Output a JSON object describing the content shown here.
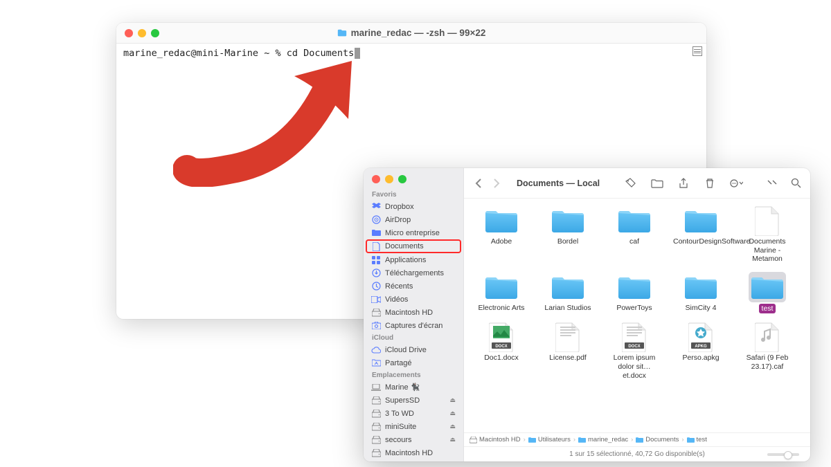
{
  "terminal": {
    "title": "marine_redac — -zsh — 99×22",
    "prompt": "marine_redac@mini-Marine ~ % ",
    "command": "cd Documents"
  },
  "finder": {
    "toolbar": {
      "title": "Documents — Local"
    },
    "sidebar": {
      "sections": [
        {
          "label": "Favoris",
          "items": [
            {
              "icon": "dropbox",
              "label": "Dropbox"
            },
            {
              "icon": "airdrop",
              "label": "AirDrop"
            },
            {
              "icon": "folder",
              "label": "Micro entreprise"
            },
            {
              "icon": "doc",
              "label": "Documents",
              "highlight": true
            },
            {
              "icon": "grid",
              "label": "Applications"
            },
            {
              "icon": "download",
              "label": "Téléchargements"
            },
            {
              "icon": "clock",
              "label": "Récents"
            },
            {
              "icon": "video",
              "label": "Vidéos"
            },
            {
              "icon": "disk",
              "label": "Macintosh HD"
            },
            {
              "icon": "camera",
              "label": "Captures d'écran"
            }
          ]
        },
        {
          "label": "iCloud",
          "items": [
            {
              "icon": "icloud",
              "label": "iCloud Drive"
            },
            {
              "icon": "shared",
              "label": "Partagé"
            }
          ]
        },
        {
          "label": "Emplacements",
          "items": [
            {
              "icon": "laptop",
              "label": "Marine 🐈‍⬛"
            },
            {
              "icon": "disk",
              "label": "SupersSD",
              "eject": true
            },
            {
              "icon": "disk",
              "label": "3 To WD",
              "eject": true
            },
            {
              "icon": "disk",
              "label": "miniSuite",
              "eject": true
            },
            {
              "icon": "disk",
              "label": "secours",
              "eject": true
            },
            {
              "icon": "disk",
              "label": "Macintosh HD"
            }
          ]
        }
      ]
    },
    "items": [
      {
        "type": "folder",
        "label": "Adobe"
      },
      {
        "type": "folder",
        "label": "Bordel"
      },
      {
        "type": "folder",
        "label": "caf"
      },
      {
        "type": "folder",
        "label": "ContourDesignSoftware"
      },
      {
        "type": "txt",
        "label": "Documents Marine - Metamon"
      },
      {
        "type": "folder",
        "label": "Electronic Arts"
      },
      {
        "type": "folder",
        "label": "Larian Studios"
      },
      {
        "type": "folder",
        "label": "PowerToys"
      },
      {
        "type": "folder",
        "label": "SimCity 4"
      },
      {
        "type": "folder",
        "label": "test",
        "selected": true
      },
      {
        "type": "docx",
        "label": "Doc1.docx",
        "badge": "DOCX",
        "thumb": "photo"
      },
      {
        "type": "pdf",
        "label": "License.pdf",
        "thumb": "text"
      },
      {
        "type": "docx",
        "label": "Lorem ipsum dolor sit…et.docx",
        "badge": "DOCX",
        "thumb": "text"
      },
      {
        "type": "apkg",
        "label": "Perso.apkg",
        "badge": "APKG",
        "thumb": "anki"
      },
      {
        "type": "caf",
        "label": "Safari (9 Feb 23.17).caf",
        "thumb": "audio"
      }
    ],
    "path": [
      "Macintosh HD",
      "Utilisateurs",
      "marine_redac",
      "Documents",
      "test"
    ],
    "status": "1 sur 15 sélectionné, 40,72 Go disponible(s)"
  }
}
